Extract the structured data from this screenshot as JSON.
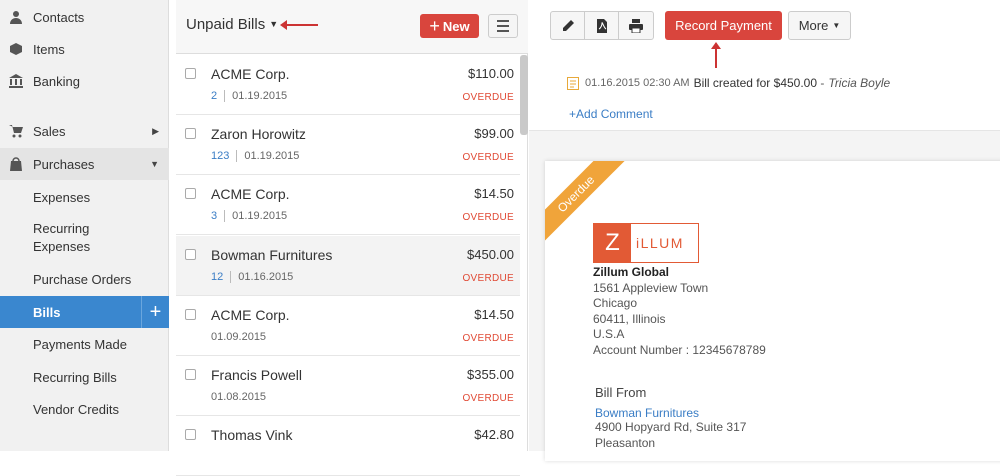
{
  "sidebar": {
    "items": [
      {
        "label": "Contacts",
        "icon": "contacts-icon"
      },
      {
        "label": "Items",
        "icon": "items-icon"
      },
      {
        "label": "Banking",
        "icon": "bank-icon"
      },
      {
        "label": "Sales",
        "icon": "cart-icon"
      },
      {
        "label": "Purchases",
        "icon": "bag-icon"
      }
    ],
    "sub_items": {
      "expenses": "Expenses",
      "recurring_expenses_1": "Recurring",
      "recurring_expenses_2": "Expenses",
      "purchase_orders": "Purchase Orders",
      "bills": "Bills",
      "payments_made": "Payments Made",
      "recurring_bills": "Recurring Bills",
      "vendor_credits": "Vendor Credits"
    }
  },
  "list": {
    "title": "Unpaid Bills",
    "new_label": "New",
    "rows": [
      {
        "vendor": "ACME Corp.",
        "amount": "$110.00",
        "number": "2",
        "date": "01.19.2015",
        "status": "OVERDUE"
      },
      {
        "vendor": "Zaron Horowitz",
        "amount": "$99.00",
        "number": "123",
        "date": "01.19.2015",
        "status": "OVERDUE"
      },
      {
        "vendor": "ACME Corp.",
        "amount": "$14.50",
        "number": "3",
        "date": "01.19.2015",
        "status": "OVERDUE"
      },
      {
        "vendor": "Bowman Furnitures",
        "amount": "$450.00",
        "number": "12",
        "date": "01.16.2015",
        "status": "OVERDUE"
      },
      {
        "vendor": "ACME Corp.",
        "amount": "$14.50",
        "number": "",
        "date": "01.09.2015",
        "status": "OVERDUE"
      },
      {
        "vendor": "Francis Powell",
        "amount": "$355.00",
        "number": "",
        "date": "01.08.2015",
        "status": "OVERDUE"
      },
      {
        "vendor": "Thomas Vink",
        "amount": "$42.80",
        "number": "",
        "date": "",
        "status": ""
      }
    ]
  },
  "detail": {
    "toolbar": {
      "record_payment": "Record Payment",
      "more": "More"
    },
    "activity": {
      "timestamp": "01.16.2015 02:30 AM",
      "text": "Bill created for",
      "amount": "$450.00",
      "dash": "-",
      "user": "Tricia Boyle"
    },
    "add_comment": "Add Comment",
    "bill": {
      "ribbon": "Overdue",
      "logo_letter": "Z",
      "logo_rest": "iLLUM",
      "org_name": "Zillum Global",
      "address": [
        "1561 Appleview Town",
        "Chicago",
        "60411, Illinois",
        "U.S.A",
        "Account Number : 12345678789"
      ],
      "bill_from_label": "Bill From",
      "vendor_name": "Bowman Furnitures",
      "vendor_address": [
        "4900 Hopyard Rd, Suite 317",
        "Pleasanton"
      ]
    }
  },
  "colors": {
    "accent_red": "#d9453d",
    "active_blue": "#3a87cf",
    "overdue": "#e04a35",
    "ribbon": "#f0a43a"
  }
}
